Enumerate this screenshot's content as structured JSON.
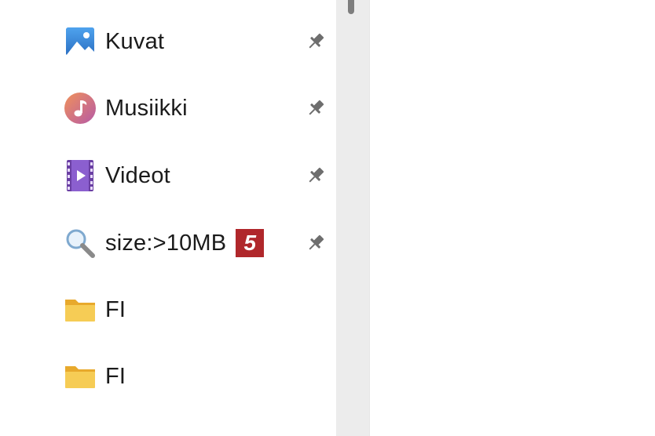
{
  "navigation": {
    "items": [
      {
        "label": "Kuvat",
        "icon": "pictures-icon",
        "pinned": true
      },
      {
        "label": "Musiikki",
        "icon": "music-icon",
        "pinned": true
      },
      {
        "label": "Videot",
        "icon": "videos-icon",
        "pinned": true
      },
      {
        "label": "size:>10MB",
        "icon": "search-icon",
        "pinned": true,
        "badge": "5"
      },
      {
        "label": "FI",
        "icon": "folder-icon",
        "pinned": false
      },
      {
        "label": "FI",
        "icon": "folder-icon",
        "pinned": false
      }
    ]
  },
  "colors": {
    "badge_background": "#b0272b",
    "folder_yellow": "#f3c54f",
    "scrollbar_track": "#ececec"
  }
}
